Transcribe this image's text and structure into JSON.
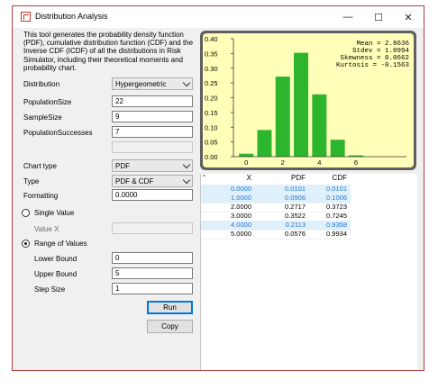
{
  "window": {
    "title": "Distribution Analysis"
  },
  "titlebar": {
    "minimize_glyph": "—",
    "maximize_glyph": "☐",
    "close_glyph": "✕"
  },
  "description": "This tool generates the probability density function (PDF), cumulative distribution function (CDF) and the Inverse CDF (ICDF) of all the distributions in Risk Simulator, including their theoretical moments and probability chart.",
  "form": {
    "distribution_label": "Distribution",
    "distribution_value": "Hypergeometric",
    "population_size_label": "PopulationSize",
    "population_size_value": "22",
    "sample_size_label": "SampleSize",
    "sample_size_value": "9",
    "population_successes_label": "PopulationSuccesses",
    "population_successes_value": "7",
    "chart_type_label": "Chart type",
    "chart_type_value": "PDF",
    "type_label": "Type",
    "type_value": "PDF & CDF",
    "formatting_label": "Formatting",
    "formatting_value": "0.0000",
    "single_value_label": "Single Value",
    "value_x_label": "Value X",
    "range_label": "Range of Values",
    "lower_bound_label": "Lower Bound",
    "lower_bound_value": "0",
    "upper_bound_label": "Upper Bound",
    "upper_bound_value": "5",
    "step_size_label": "Step Size",
    "step_size_value": "1",
    "run_label": "Run",
    "copy_label": "Copy"
  },
  "chart_data": {
    "type": "bar",
    "categories": [
      0,
      1,
      2,
      3,
      4,
      5,
      6
    ],
    "values": [
      0.0101,
      0.0906,
      0.2717,
      0.3522,
      0.2113,
      0.0576,
      0.0045
    ],
    "ylim": [
      0,
      0.4
    ],
    "yticks": [
      "0.40",
      "0.35",
      "0.30",
      "0.25",
      "0.20",
      "0.15",
      "0.10",
      "0.05",
      "0.00"
    ],
    "xticks": [
      "0",
      "2",
      "4",
      "6"
    ],
    "bar_color": "#2db52d",
    "stats": [
      "Mean = 2.8636",
      "Stdev = 1.0994",
      "Skewness = 0.0662",
      "Kurtosis = -0.1563"
    ]
  },
  "table": {
    "headers": [
      "X",
      "PDF",
      "CDF"
    ],
    "rows": [
      {
        "x": "0.0000",
        "pdf": "0.0101",
        "cdf": "0.0101",
        "selected": true
      },
      {
        "x": "1.0000",
        "pdf": "0.0906",
        "cdf": "0.1006",
        "selected": true
      },
      {
        "x": "2.0000",
        "pdf": "0.2717",
        "cdf": "0.3723",
        "selected": false
      },
      {
        "x": "3.0000",
        "pdf": "0.3522",
        "cdf": "0.7245",
        "selected": false
      },
      {
        "x": "4.0000",
        "pdf": "0.2113",
        "cdf": "0.9358",
        "selected": true
      },
      {
        "x": "5.0000",
        "pdf": "0.0576",
        "cdf": "0.9934",
        "selected": false
      }
    ]
  }
}
